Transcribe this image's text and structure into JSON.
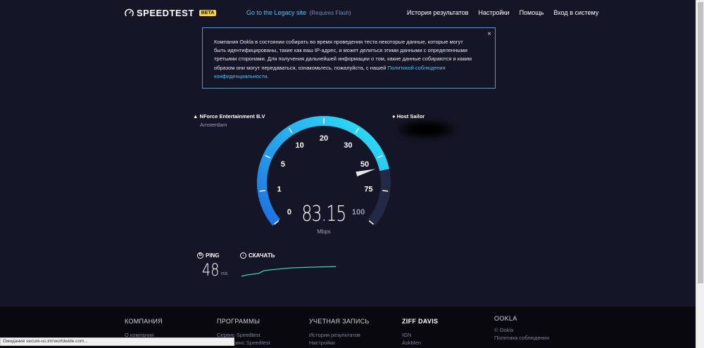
{
  "header": {
    "logo_text": "SPEEDTEST",
    "beta": "BETA",
    "legacy_link": "Go to the Legacy site",
    "legacy_note": "(Requires Flash)",
    "nav": [
      "История результатов",
      "Настройки",
      "Помощь",
      "Вход в систему"
    ]
  },
  "notice": {
    "text": "Компания Ookla в состоянии собирать во время проведения теста некоторые данные, которые могут быть идентифицированы, такие как ваш IP-адрес, и может делиться этими данными с определенными третьими сторонами. Для получения дальнейшей информации о том, какие данные собираются и каким образом они могут передаваться, ознакомьтесь, пожалуйста, с нашей ",
    "link": "Политикой соблюдения конфиденциальности",
    "end": ".",
    "close": "×"
  },
  "server": {
    "isp": "NForce Entertainment B.V",
    "isp_location": "Amsterdam",
    "host": "Host Sailor"
  },
  "gauge": {
    "ticks": [
      "0",
      "1",
      "5",
      "10",
      "20",
      "30",
      "50",
      "75",
      "100"
    ],
    "value": "83.15",
    "unit": "Mbps",
    "fill_fraction": 0.8,
    "colors": {
      "start": "#1e6fe0",
      "end": "#2ee6f7",
      "track": "#232844"
    }
  },
  "ping": {
    "label": "PING",
    "value": "48",
    "unit": "ms"
  },
  "download": {
    "label": "СКАЧАТЬ",
    "color": "#3fd1b0"
  },
  "footer": {
    "columns": [
      {
        "head": "КОМПАНИЯ",
        "links": [
          "О компании"
        ]
      },
      {
        "head": "ПРОГРАММЫ",
        "links": [
          "Сервис Speedtest",
          "ный сервис Speedtest"
        ]
      },
      {
        "head": "УЧЕТНАЯ ЗАПИСЬ",
        "links": [
          "История результатов",
          "Настройки"
        ]
      },
      {
        "head": "ZIFF DAVIS",
        "links": [
          "IGN",
          "AskMen"
        ]
      },
      {
        "head": "OOKLA",
        "links": [
          "© Ookla",
          "Политика соблюдения"
        ]
      }
    ]
  },
  "status_bar": "Ожидание secure-us.imrworldwide.com..."
}
